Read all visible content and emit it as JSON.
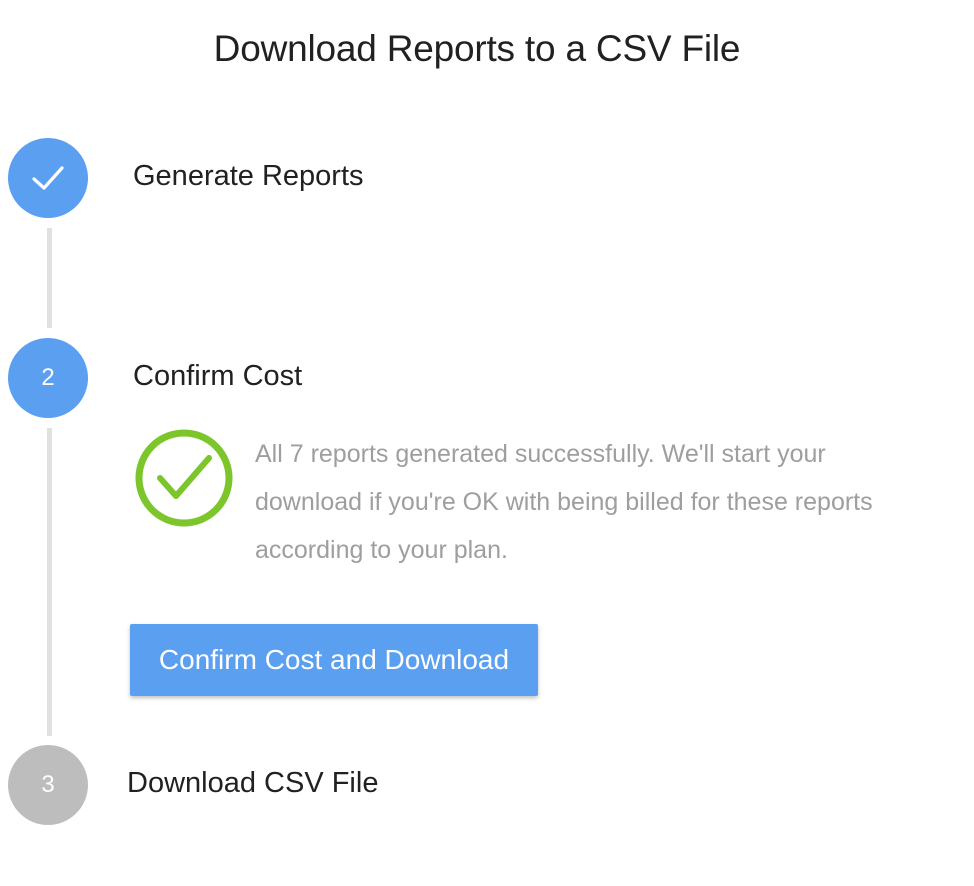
{
  "page": {
    "title": "Download Reports to a CSV File"
  },
  "steps": [
    {
      "indicator": "check-icon",
      "label": "Generate Reports",
      "state": "complete",
      "color": "#5a9ff0"
    },
    {
      "indicator": "2",
      "label": "Confirm Cost",
      "state": "active",
      "color": "#5a9ff0",
      "success_icon": "success-check-icon",
      "success_color": "#7cc52a",
      "message": "All 7 reports generated successfully. We'll start your download if you're OK with being billed for these reports according to your plan.",
      "button_label": "Confirm Cost and Download"
    },
    {
      "indicator": "3",
      "label": "Download CSV File",
      "state": "pending",
      "color": "#bdbdbd"
    }
  ],
  "colors": {
    "accent": "#5a9ff0",
    "success": "#7cc52a",
    "muted_text": "#9e9e9e",
    "connector": "#e0e0e0"
  }
}
